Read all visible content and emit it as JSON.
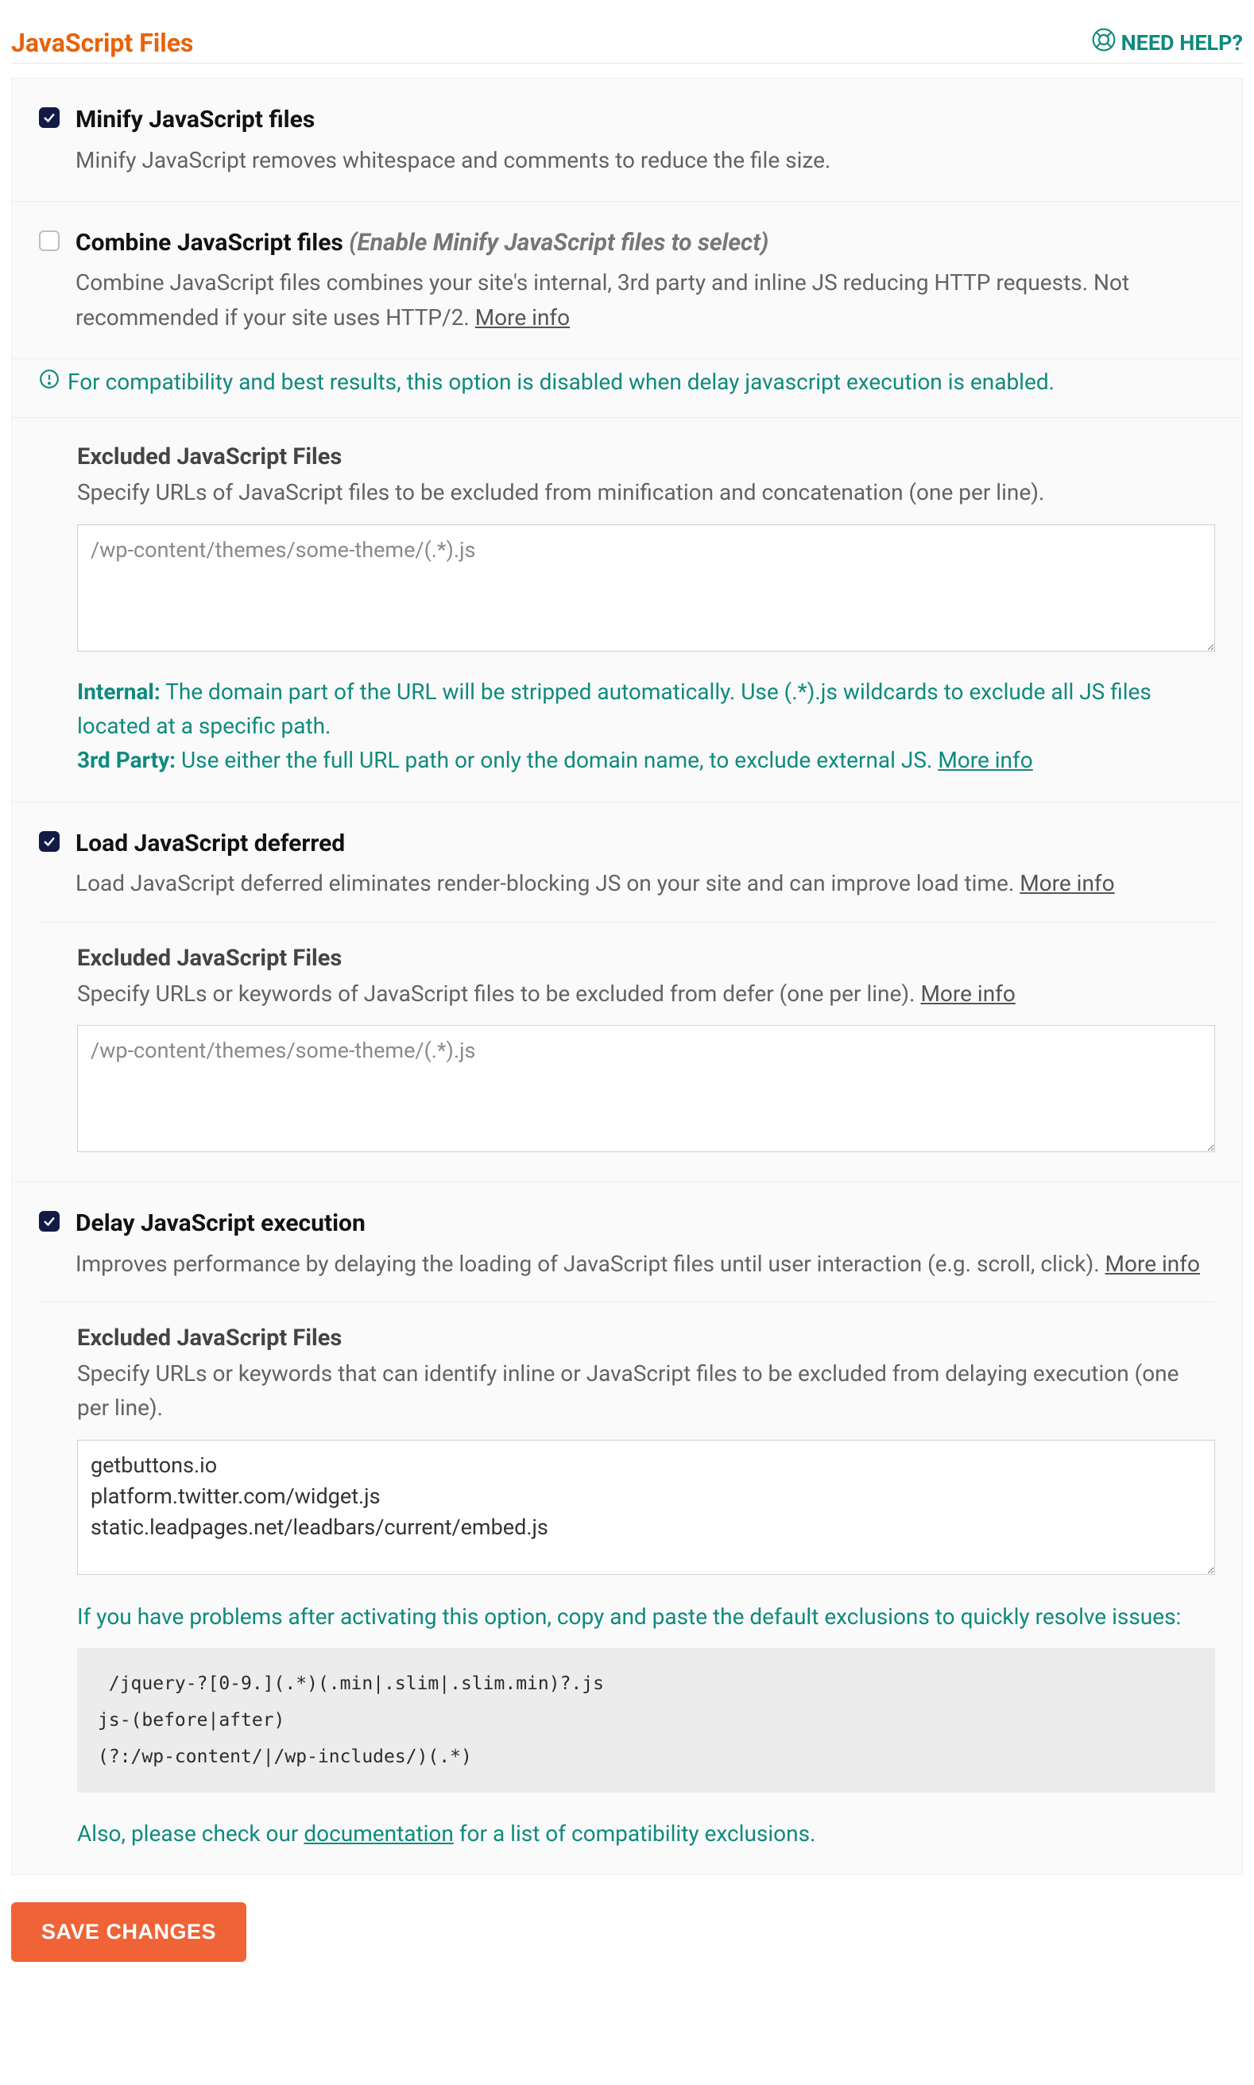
{
  "header": {
    "title": "JavaScript Files",
    "help": "NEED HELP?"
  },
  "sections": {
    "minify": {
      "title": "Minify JavaScript files",
      "desc": "Minify JavaScript removes whitespace and comments to reduce the file size."
    },
    "combine": {
      "title": "Combine JavaScript files ",
      "disabled_note": "(Enable Minify JavaScript files to select)",
      "desc": "Combine JavaScript files combines your site's internal, 3rd party and inline JS reducing HTTP requests. Not recommended if your site uses HTTP/2. ",
      "more": "More info",
      "compat": "For compatibility and best results, this option is disabled when delay javascript execution is enabled."
    },
    "excluded_minify": {
      "title": "Excluded JavaScript Files",
      "desc": "Specify URLs of JavaScript files to be excluded from minification and concatenation (one per line).",
      "placeholder": "/wp-content/themes/some-theme/(.*).js",
      "note_internal_label": "Internal:",
      "note_internal_text": " The domain part of the URL will be stripped automatically. Use (.*).js wildcards to exclude all JS files located at a specific path.",
      "note_3p_label": "3rd Party:",
      "note_3p_text": " Use either the full URL path or only the domain name, to exclude external JS. ",
      "more": "More info"
    },
    "defer": {
      "title": "Load JavaScript deferred",
      "desc": "Load JavaScript deferred eliminates render-blocking JS on your site and can improve load time. ",
      "more": "More info"
    },
    "excluded_defer": {
      "title": "Excluded JavaScript Files",
      "desc": "Specify URLs or keywords of JavaScript files to be excluded from defer (one per line). ",
      "more": "More info",
      "placeholder": "/wp-content/themes/some-theme/(.*).js"
    },
    "delay": {
      "title": "Delay JavaScript execution",
      "desc": "Improves performance by delaying the loading of JavaScript files until user interaction (e.g. scroll, click). ",
      "more": "More info"
    },
    "excluded_delay": {
      "title": "Excluded JavaScript Files",
      "desc": "Specify URLs or keywords that can identify inline or JavaScript files to be excluded from delaying execution (one per line).",
      "value": "getbuttons.io\nplatform.twitter.com/widget.js\nstatic.leadpages.net/leadbars/current/embed.js",
      "post_note": "If you have problems after activating this option, copy and paste the default exclusions to quickly resolve issues:",
      "code": " /jquery-?[0-9.](.*)(.min|.slim|.slim.min)?.js\njs-(before|after)\n(?:/wp-content/|/wp-includes/)(.*)",
      "doc_pre": "Also, please check our ",
      "doc_link": "documentation",
      "doc_post": " for a list of compatibility exclusions."
    }
  },
  "save_label": "SAVE CHANGES"
}
